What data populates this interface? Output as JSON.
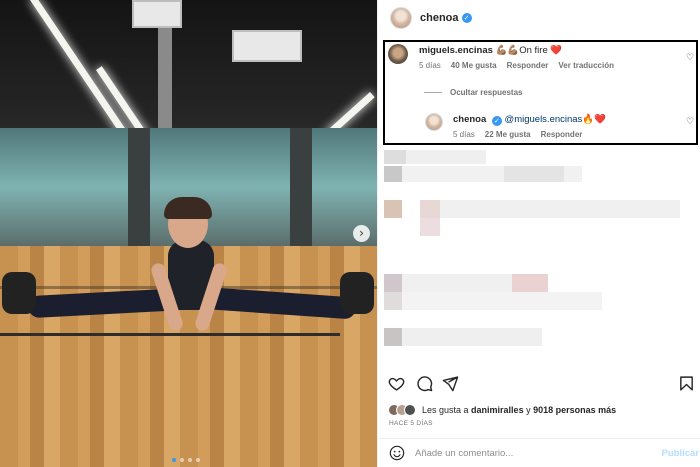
{
  "post": {
    "author": "chenoa",
    "verified_icon": "verified-badge-icon",
    "next_icon": "›"
  },
  "comments": [
    {
      "username": "miguels.encinas",
      "text": "💪🏽💪🏽On fire ❤️",
      "age": "5 días",
      "likes": "40 Me gusta",
      "reply": "Responder",
      "translate": "Ver traducción"
    }
  ],
  "hide_replies": "Ocultar respuestas",
  "reply": {
    "username": "chenoa",
    "mention": "@miguels.encinas",
    "emoji": "🔥❤️",
    "age": "5 días",
    "likes": "22 Me gusta",
    "reply": "Responder"
  },
  "likes_line": {
    "prefix": "Les gusta a ",
    "user": "danimiralles",
    "middle": " y ",
    "count": "9018 personas más"
  },
  "date": "HACE 5 DÍAS",
  "add_comment": {
    "placeholder": "Añade un comentario...",
    "publish": "Publicar"
  },
  "colors": {
    "accent": "#3897f0",
    "highlight_border": "#000000",
    "publish_disabled": "#b2dffc"
  }
}
